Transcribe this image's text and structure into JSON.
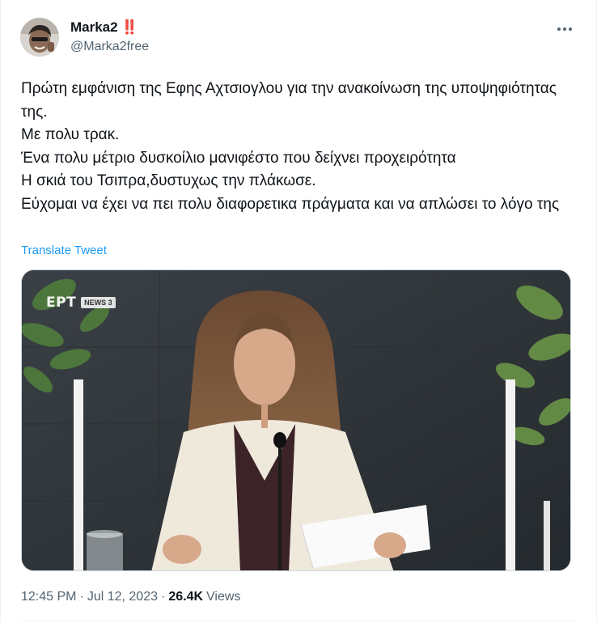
{
  "author": {
    "display_name": "Marka2",
    "emoji": "‼️",
    "handle": "@Marka2free"
  },
  "tweet": {
    "lines": [
      "Πρώτη εμφάνιση της Εφης Αχτσιογλου για την ανακοίνωση της υποψηφιότητας της.",
      "Με πολυ τρακ.",
      "Ένα πολυ μέτριο δυσκοίλιο μανιφέστο που δείχνει προχειρότητα",
      "Η σκιά του Τσιπρα,δυστυχως την πλάκωσε.",
      "Εύχομαι να έχει να πει πολυ διαφορετικα πράγματα και να απλώσει το λόγο της"
    ],
    "translate_label": "Translate Tweet"
  },
  "media": {
    "channel_logo": "ΕΡΤ",
    "channel_badge": "NEWS 3"
  },
  "meta": {
    "time": "12:45 PM",
    "separator": "·",
    "date": "Jul 12, 2023",
    "views_count": "26.4K",
    "views_label": "Views"
  },
  "colors": {
    "link": "#1d9bf0",
    "secondary_text": "#536471",
    "primary_text": "#0f1419"
  }
}
